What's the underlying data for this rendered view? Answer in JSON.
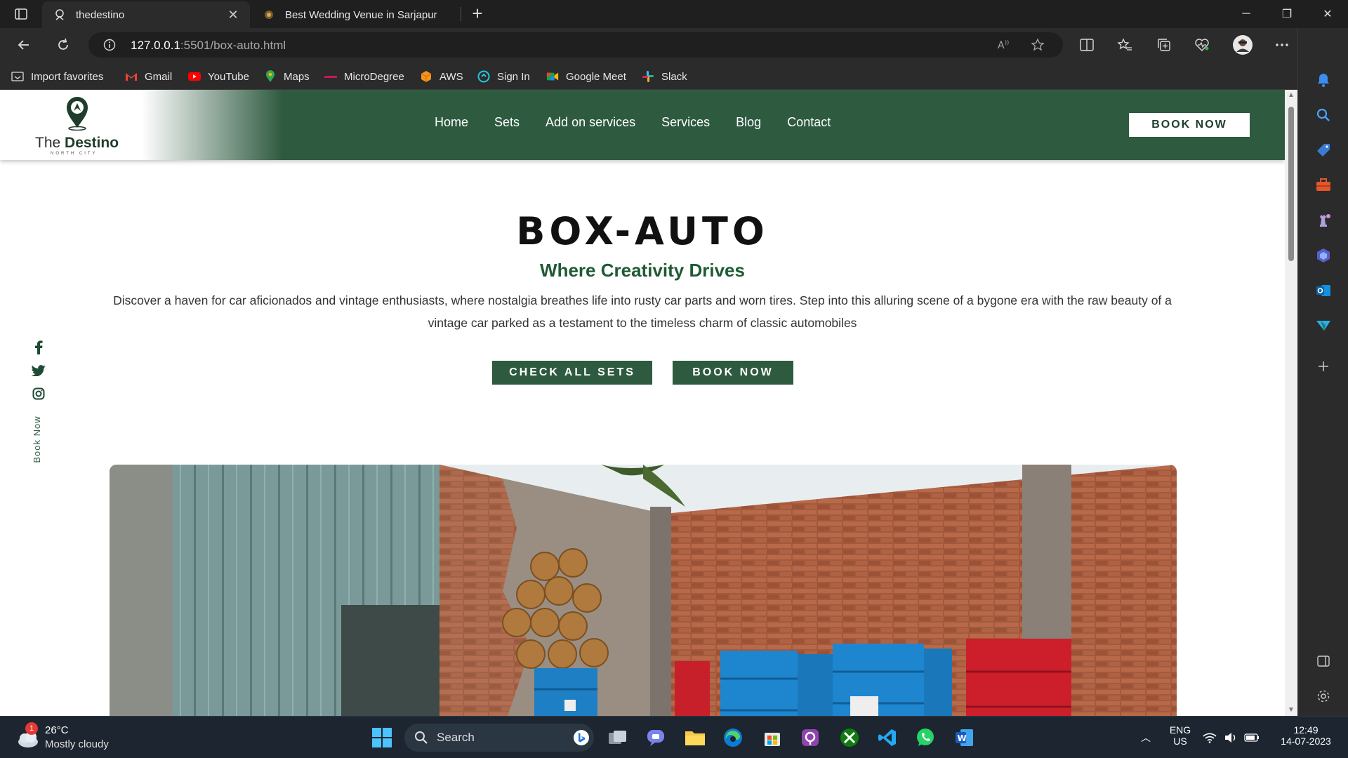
{
  "browser": {
    "tabs": [
      {
        "title": "thedestino",
        "active": true
      },
      {
        "title": "Best Wedding Venue in Sarjapur",
        "active": false
      }
    ],
    "url_host": "127.0.0.1",
    "url_path": ":5501/box-auto.html",
    "bookmarks": [
      "Import favorites",
      "Gmail",
      "YouTube",
      "Maps",
      "MicroDegree",
      "AWS",
      "Sign In",
      "Google Meet",
      "Slack"
    ]
  },
  "site": {
    "logo_the": "The ",
    "logo_destino": "Destino",
    "logo_sub": "NORTH CITY",
    "nav": [
      "Home",
      "Sets",
      "Add on services",
      "Services",
      "Blog",
      "Contact"
    ],
    "nav_book": "BOOK NOW",
    "side_book": "Book Now",
    "title": "BOX-AUTO",
    "subtitle": "Where Creativity Drives",
    "description": "Discover a haven for car aficionados and vintage enthusiasts, where nostalgia breathes life into rusty car parts and worn tires. Step into this alluring scene of a bygone era with the raw beauty of a vintage car parked as a testament to the timeless charm of classic automobiles",
    "btn_sets": "CHECK ALL SETS",
    "btn_book": "BOOK NOW",
    "accent": "#2e5a40"
  },
  "taskbar": {
    "temp": "26°C",
    "condition": "Mostly cloudy",
    "badge": "1",
    "search": "Search",
    "lang1": "ENG",
    "lang2": "US",
    "time": "12:49",
    "date": "14-07-2023"
  }
}
